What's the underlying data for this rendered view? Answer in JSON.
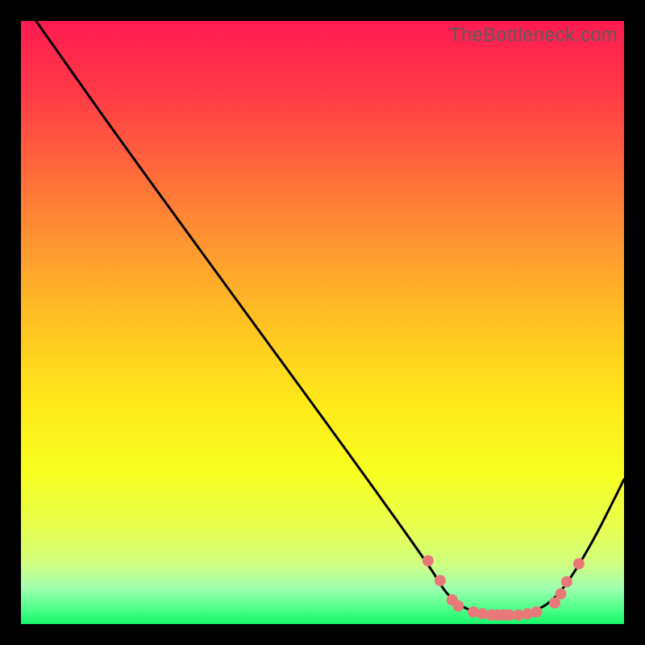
{
  "attribution": "TheBottleneck.com",
  "chart_data": {
    "type": "line",
    "title": "",
    "xlabel": "",
    "ylabel": "",
    "xlim": [
      0,
      100
    ],
    "ylim": [
      0,
      100
    ],
    "curve": [
      {
        "x": 2.5,
        "y": 100
      },
      {
        "x": 18,
        "y": 78
      },
      {
        "x": 67,
        "y": 11
      },
      {
        "x": 71,
        "y": 4
      },
      {
        "x": 76,
        "y": 1.5
      },
      {
        "x": 82,
        "y": 1.5
      },
      {
        "x": 88,
        "y": 3
      },
      {
        "x": 94,
        "y": 12
      },
      {
        "x": 100,
        "y": 24
      }
    ],
    "markers": [
      {
        "x": 67.5,
        "y": 10.5
      },
      {
        "x": 69.5,
        "y": 7.2
      },
      {
        "x": 71.5,
        "y": 4.0
      },
      {
        "x": 72.5,
        "y": 3.0
      },
      {
        "x": 75.0,
        "y": 2.0
      },
      {
        "x": 76.5,
        "y": 1.7
      },
      {
        "x": 78.0,
        "y": 1.5
      },
      {
        "x": 79.0,
        "y": 1.5
      },
      {
        "x": 80.0,
        "y": 1.5
      },
      {
        "x": 81.0,
        "y": 1.5
      },
      {
        "x": 82.5,
        "y": 1.5
      },
      {
        "x": 84.0,
        "y": 1.7
      },
      {
        "x": 85.5,
        "y": 2.0
      },
      {
        "x": 88.5,
        "y": 3.5
      },
      {
        "x": 89.5,
        "y": 5.0
      },
      {
        "x": 90.5,
        "y": 7.0
      },
      {
        "x": 92.5,
        "y": 10.0
      }
    ],
    "marker_style": {
      "color": "#e97878",
      "radius": 7
    },
    "line_style": {
      "color": "#000000",
      "width": 3
    },
    "gradient_stops": [
      {
        "pos": 0,
        "color": "#ff1a52"
      },
      {
        "pos": 12,
        "color": "#ff3a47"
      },
      {
        "pos": 25,
        "color": "#ff6a3a"
      },
      {
        "pos": 38,
        "color": "#ff9a30"
      },
      {
        "pos": 50,
        "color": "#ffc222"
      },
      {
        "pos": 63,
        "color": "#ffe81a"
      },
      {
        "pos": 75,
        "color": "#f7ff20"
      },
      {
        "pos": 84,
        "color": "#e8ff50"
      },
      {
        "pos": 90,
        "color": "#d0ff80"
      },
      {
        "pos": 94,
        "color": "#a0ffb0"
      },
      {
        "pos": 97,
        "color": "#5aff90"
      },
      {
        "pos": 100,
        "color": "#15f86a"
      }
    ]
  }
}
